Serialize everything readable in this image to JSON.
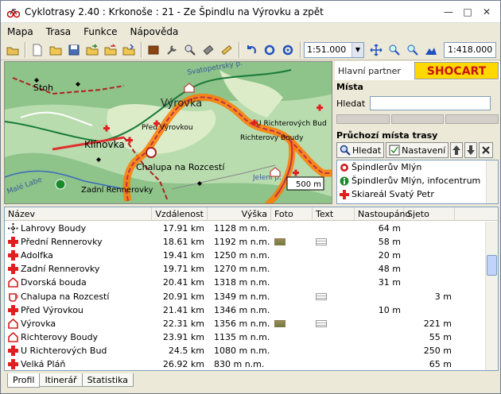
{
  "window": {
    "title": "Cyklotrasy 2.40 : Krkonoše : 21 - Ze Špindlu na Výrovku a zpět"
  },
  "menu": [
    "Mapa",
    "Trasa",
    "Funkce",
    "Nápověda"
  ],
  "toolbar": {
    "scale_value": "1:51.000",
    "scale_display": "1:418.000"
  },
  "map": {
    "labels": {
      "stoh": "Stoh",
      "vyrovka": "Výrovka",
      "klinovka": "Klínovka",
      "pred_vyrovkou": "Před Výrovkou",
      "chalupa": "Chalupa na Rozcestí",
      "zadni": "Zadní Rennerovky",
      "u_richterovych": "U Richterových Bud",
      "richterovy": "Richterovy Boudy",
      "jeleni": "Jelení p.",
      "male_labe": "Malé Labe",
      "svatopetrsky": "Svatopetrský p."
    },
    "scalebar": "500 m"
  },
  "right_panel": {
    "partner_label": "Hlavní partner",
    "logo_text": "SHOCART",
    "places_heading": "Místa",
    "search_label": "Hledat",
    "route_heading": "Průchozí místa trasy",
    "search_button": "Hledat",
    "settings_button": "Nastavení",
    "route_places": [
      "Špindlerův Mlýn",
      "Špindlerův Mlýn, infocentrum",
      "Skiareál Svatý Petr"
    ]
  },
  "table": {
    "columns": [
      "Název",
      "Vzdálenost",
      "Výška",
      "Foto",
      "Text",
      "Nastoupáno",
      "Sjeto"
    ],
    "rows": [
      {
        "icon": "crossroad-icon",
        "name": "Lahrovy Boudy",
        "dist": "17.91 km",
        "alt": "1128 m n.m.",
        "foto": false,
        "text": false,
        "up": "64 m",
        "down": ""
      },
      {
        "icon": "red-cross-icon",
        "name": "Přední Rennerovky",
        "dist": "18.61 km",
        "alt": "1192 m n.m.",
        "foto": true,
        "text": true,
        "up": "58 m",
        "down": ""
      },
      {
        "icon": "red-cross-icon",
        "name": "Adolfka",
        "dist": "19.41 km",
        "alt": "1250 m n.m.",
        "foto": false,
        "text": false,
        "up": "20 m",
        "down": ""
      },
      {
        "icon": "red-cross-icon",
        "name": "Zadní Rennerovky",
        "dist": "19.71 km",
        "alt": "1270 m n.m.",
        "foto": false,
        "text": false,
        "up": "48 m",
        "down": ""
      },
      {
        "icon": "house-icon",
        "name": "Dvorská bouda",
        "dist": "20.41 km",
        "alt": "1318 m n.m.",
        "foto": false,
        "text": false,
        "up": "31 m",
        "down": ""
      },
      {
        "icon": "cup-icon",
        "name": "Chalupa na Rozcestí",
        "dist": "20.91 km",
        "alt": "1349 m n.m.",
        "foto": false,
        "text": true,
        "up": "",
        "down": "3 m"
      },
      {
        "icon": "red-cross-icon",
        "name": "Před Výrovkou",
        "dist": "21.41 km",
        "alt": "1346 m n.m.",
        "foto": false,
        "text": false,
        "up": "10 m",
        "down": ""
      },
      {
        "icon": "house-icon",
        "name": "Výrovka",
        "dist": "22.31 km",
        "alt": "1356 m n.m.",
        "foto": true,
        "text": true,
        "up": "",
        "down": "221 m"
      },
      {
        "icon": "house-icon",
        "name": "Richterovy Boudy",
        "dist": "23.91 km",
        "alt": "1135 m n.m.",
        "foto": false,
        "text": false,
        "up": "",
        "down": "55 m"
      },
      {
        "icon": "red-cross-icon",
        "name": "U Richterových Bud",
        "dist": "24.5 km",
        "alt": "1080 m n.m.",
        "foto": false,
        "text": false,
        "up": "",
        "down": "250 m"
      },
      {
        "icon": "red-cross-icon",
        "name": "Velká Pláň",
        "dist": "26.92 km",
        "alt": "830 m n.m.",
        "foto": false,
        "text": false,
        "up": "",
        "down": "65 m"
      }
    ]
  },
  "tabs": [
    "Profil",
    "Itinerář",
    "Statistika"
  ]
}
